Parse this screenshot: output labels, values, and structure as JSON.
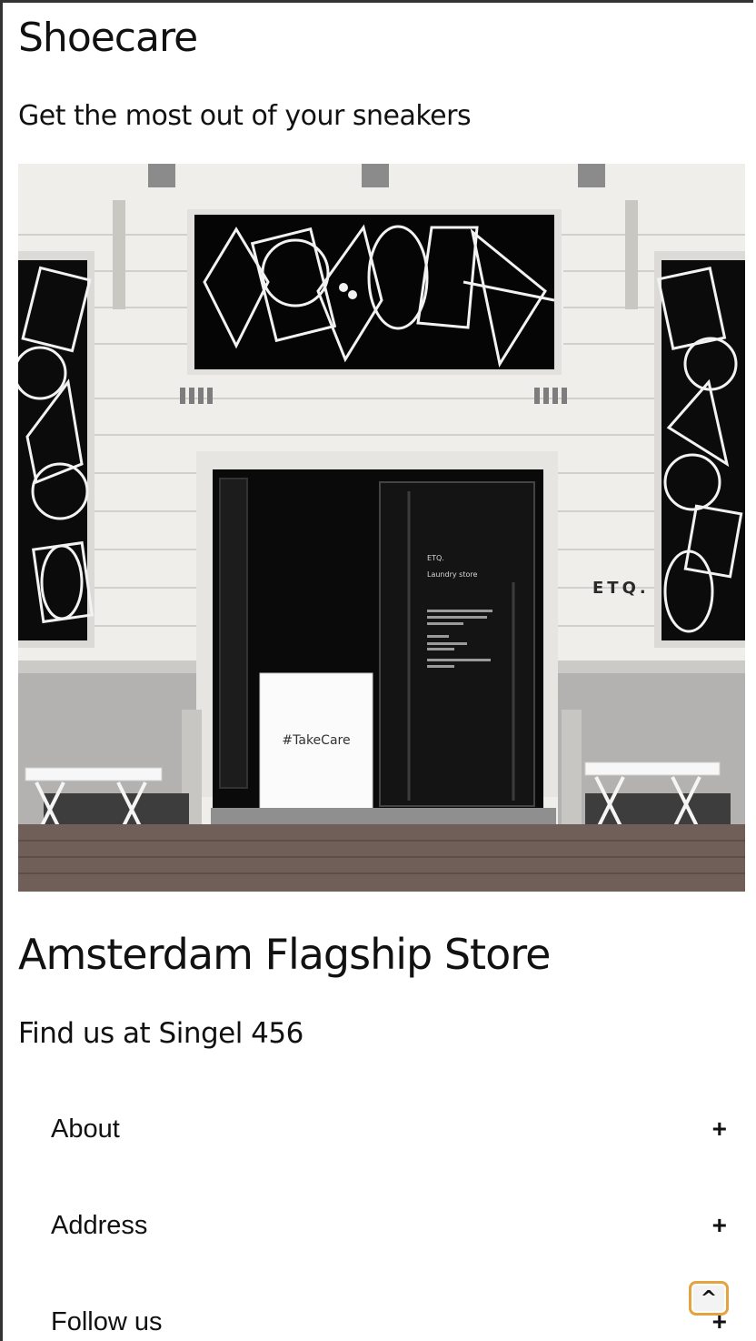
{
  "header": {
    "title": "Shoecare",
    "subtitle": "Get the most out of your sneakers"
  },
  "hero_image": {
    "window_text": "ETQ.",
    "door_sign": "ETQ.",
    "door_sign_sub": "Laundry store",
    "counter_text": "#TakeCare"
  },
  "store": {
    "title": "Amsterdam Flagship Store",
    "address": "Find us at Singel 456"
  },
  "accordion": [
    {
      "label": "About",
      "toggle": "+"
    },
    {
      "label": "Address",
      "toggle": "+"
    },
    {
      "label": "Follow us",
      "toggle": "+"
    }
  ],
  "back_to_top": {
    "label": "^"
  },
  "colors": {
    "accent": "#e3a33e",
    "text": "#111111",
    "frame": "#333333"
  }
}
